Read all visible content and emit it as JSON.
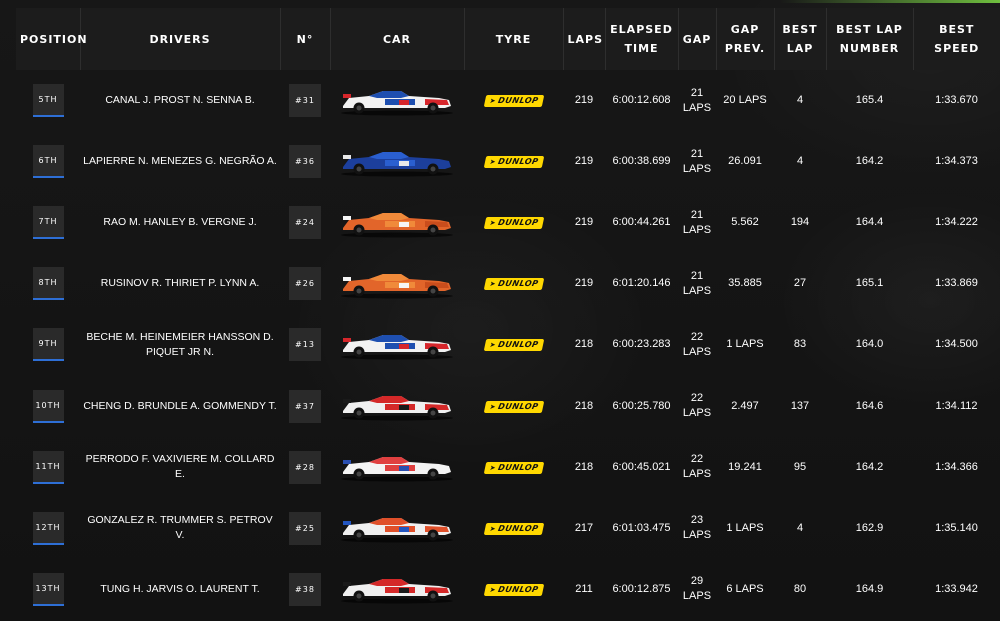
{
  "headers": {
    "position": "POSITION",
    "drivers": "DRIVERS",
    "number": "N°",
    "car": "CAR",
    "tyre": "TYRE",
    "laps": "LAPS",
    "elapsed_1": "ELAPSED",
    "elapsed_2": "TIME",
    "gap": "GAP",
    "gap_prev_1": "GAP",
    "gap_prev_2": "PREV.",
    "best_lap_1": "BEST",
    "best_lap_2": "LAP",
    "best_lap_number_1": "BEST LAP",
    "best_lap_number_2": "NUMBER",
    "best_speed_1": "BEST",
    "best_speed_2": "SPEED"
  },
  "colors": {
    "position_underline": "#2e6fd6",
    "tyre_badge": "#ffd800",
    "accent": "#6fbf3f"
  },
  "rows": [
    {
      "position": "5TH",
      "drivers": "CANAL J. PROST N. SENNA B.",
      "number": "#31",
      "car_icon": "race-car-icon",
      "car_color": "blue-red",
      "tyre_icon": "dunlop-logo-icon",
      "tyre": "DUNLOP",
      "laps": "219",
      "elapsed": "6:00:12.608",
      "gap_1": "21",
      "gap_2": "LAPS",
      "gap_prev": "20 LAPS",
      "best_lap": "4",
      "best_lap_number": "165.4",
      "best_speed": "1:33.670"
    },
    {
      "position": "6TH",
      "drivers": "LAPIERRE N. MENEZES G. NEGRÃO A.",
      "number": "#36",
      "car_icon": "race-car-icon",
      "car_color": "blue",
      "tyre_icon": "dunlop-logo-icon",
      "tyre": "DUNLOP",
      "laps": "219",
      "elapsed": "6:00:38.699",
      "gap_1": "21",
      "gap_2": "LAPS",
      "gap_prev": "26.091",
      "best_lap": "4",
      "best_lap_number": "164.2",
      "best_speed": "1:34.373"
    },
    {
      "position": "7TH",
      "drivers": "RAO M. HANLEY B. VERGNE J.",
      "number": "#24",
      "car_icon": "race-car-icon",
      "car_color": "orange",
      "tyre_icon": "dunlop-logo-icon",
      "tyre": "DUNLOP",
      "laps": "219",
      "elapsed": "6:00:44.261",
      "gap_1": "21",
      "gap_2": "LAPS",
      "gap_prev": "5.562",
      "best_lap": "194",
      "best_lap_number": "164.4",
      "best_speed": "1:34.222"
    },
    {
      "position": "8TH",
      "drivers": "RUSINOV R. THIRIET P. LYNN A.",
      "number": "#26",
      "car_icon": "race-car-icon",
      "car_color": "orange",
      "tyre_icon": "dunlop-logo-icon",
      "tyre": "DUNLOP",
      "laps": "219",
      "elapsed": "6:01:20.146",
      "gap_1": "21",
      "gap_2": "LAPS",
      "gap_prev": "35.885",
      "best_lap": "27",
      "best_lap_number": "165.1",
      "best_speed": "1:33.869"
    },
    {
      "position": "9TH",
      "drivers_1": "BECHE M. HEINEMEIER HANSSON D.",
      "drivers_2": "PIQUET JR N.",
      "number": "#13",
      "car_icon": "race-car-icon",
      "car_color": "blue-red",
      "tyre_icon": "dunlop-logo-icon",
      "tyre": "DUNLOP",
      "laps": "218",
      "elapsed": "6:00:23.283",
      "gap_1": "22",
      "gap_2": "LAPS",
      "gap_prev": "1 LAPS",
      "best_lap": "83",
      "best_lap_number": "164.0",
      "best_speed": "1:34.500"
    },
    {
      "position": "10TH",
      "drivers": "CHENG D. BRUNDLE A. GOMMENDY T.",
      "number": "#37",
      "car_icon": "race-car-icon",
      "car_color": "red-white",
      "tyre_icon": "dunlop-logo-icon",
      "tyre": "DUNLOP",
      "laps": "218",
      "elapsed": "6:00:25.780",
      "gap_1": "22",
      "gap_2": "LAPS",
      "gap_prev": "2.497",
      "best_lap": "137",
      "best_lap_number": "164.6",
      "best_speed": "1:34.112"
    },
    {
      "position": "11TH",
      "drivers": "PERRODO F. VAXIVIERE M. COLLARD E.",
      "number": "#28",
      "car_icon": "race-car-icon",
      "car_color": "white-red",
      "tyre_icon": "dunlop-logo-icon",
      "tyre": "DUNLOP",
      "laps": "218",
      "elapsed": "6:00:45.021",
      "gap_1": "22",
      "gap_2": "LAPS",
      "gap_prev": "19.241",
      "best_lap": "95",
      "best_lap_number": "164.2",
      "best_speed": "1:34.366"
    },
    {
      "position": "12TH",
      "drivers": "GONZALEZ R. TRUMMER S. PETROV V.",
      "number": "#25",
      "car_icon": "race-car-icon",
      "car_color": "red-blue",
      "tyre_icon": "dunlop-logo-icon",
      "tyre": "DUNLOP",
      "laps": "217",
      "elapsed": "6:01:03.475",
      "gap_1": "23",
      "gap_2": "LAPS",
      "gap_prev": "1 LAPS",
      "best_lap": "4",
      "best_lap_number": "162.9",
      "best_speed": "1:35.140"
    },
    {
      "position": "13TH",
      "drivers": "TUNG H. JARVIS O. LAURENT T.",
      "number": "#38",
      "car_icon": "race-car-icon",
      "car_color": "red-white",
      "tyre_icon": "dunlop-logo-icon",
      "tyre": "DUNLOP",
      "laps": "211",
      "elapsed": "6:00:12.875",
      "gap_1": "29",
      "gap_2": "LAPS",
      "gap_prev": "6 LAPS",
      "best_lap": "80",
      "best_lap_number": "164.9",
      "best_speed": "1:33.942"
    }
  ]
}
